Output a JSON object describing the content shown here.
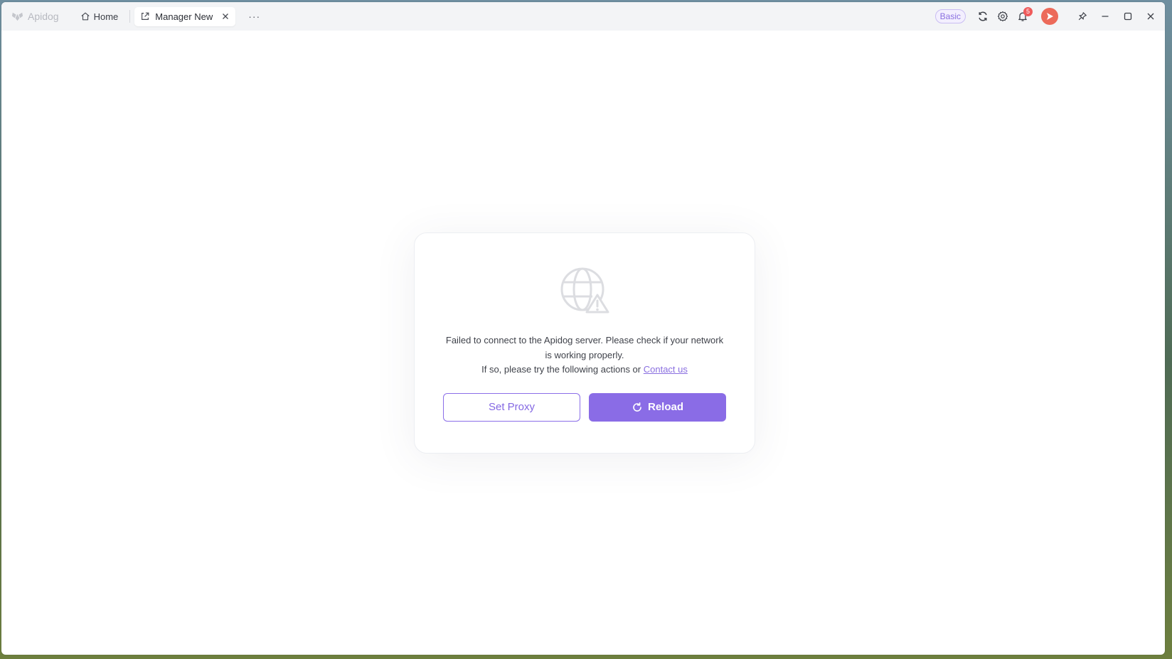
{
  "app": {
    "name": "Apidog"
  },
  "tabs": {
    "home_label": "Home",
    "active_label": "Manager New",
    "more_label": "···"
  },
  "header": {
    "plan_badge": "Basic",
    "notification_count": "5",
    "icons": [
      "sync-icon",
      "settings-gear-icon",
      "bell-icon",
      "avatar",
      "pin-icon",
      "minimize-icon",
      "maximize-icon",
      "close-icon"
    ]
  },
  "error": {
    "message_line1": "Failed to connect to the Apidog server. Please check if your network is working properly.",
    "message_line2_prefix": "If so, please try the following actions or ",
    "contact_link": "Contact us",
    "icon": "globe-warning-icon"
  },
  "actions": {
    "set_proxy_label": "Set Proxy",
    "reload_label": "Reload"
  },
  "colors": {
    "accent": "#8a6ce6",
    "notification": "#ef5b5b",
    "avatar": "#ec6a5a"
  }
}
